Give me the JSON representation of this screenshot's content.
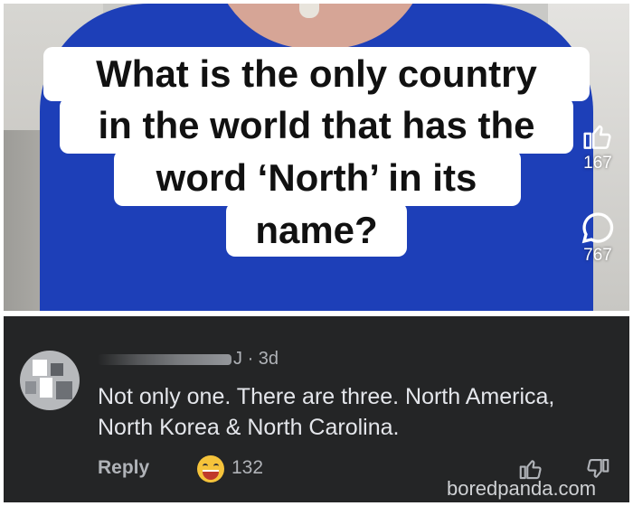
{
  "question": {
    "lines": [
      "What is the only country",
      "in the world that has the",
      "word ‘North’ in its",
      "name?"
    ]
  },
  "side_actions": {
    "likes": "167",
    "comments": "767"
  },
  "comment": {
    "author_suffix": "J",
    "separator": "·",
    "age": "3d",
    "text": "Not only one. There are three. North America, North Korea & North Carolina.",
    "reply_label": "Reply",
    "reaction_count": "132"
  },
  "watermark": "boredpanda.com",
  "colors": {
    "dress": "#1d3fb8",
    "comment_bg": "#242526",
    "comment_text": "#e4e6eb",
    "meta_text": "#b0b3b8"
  },
  "icons": [
    "like-thumb-icon",
    "comment-bubble-icon",
    "laughing-emoji-icon",
    "thumbs-up-icon",
    "thumbs-down-icon"
  ]
}
